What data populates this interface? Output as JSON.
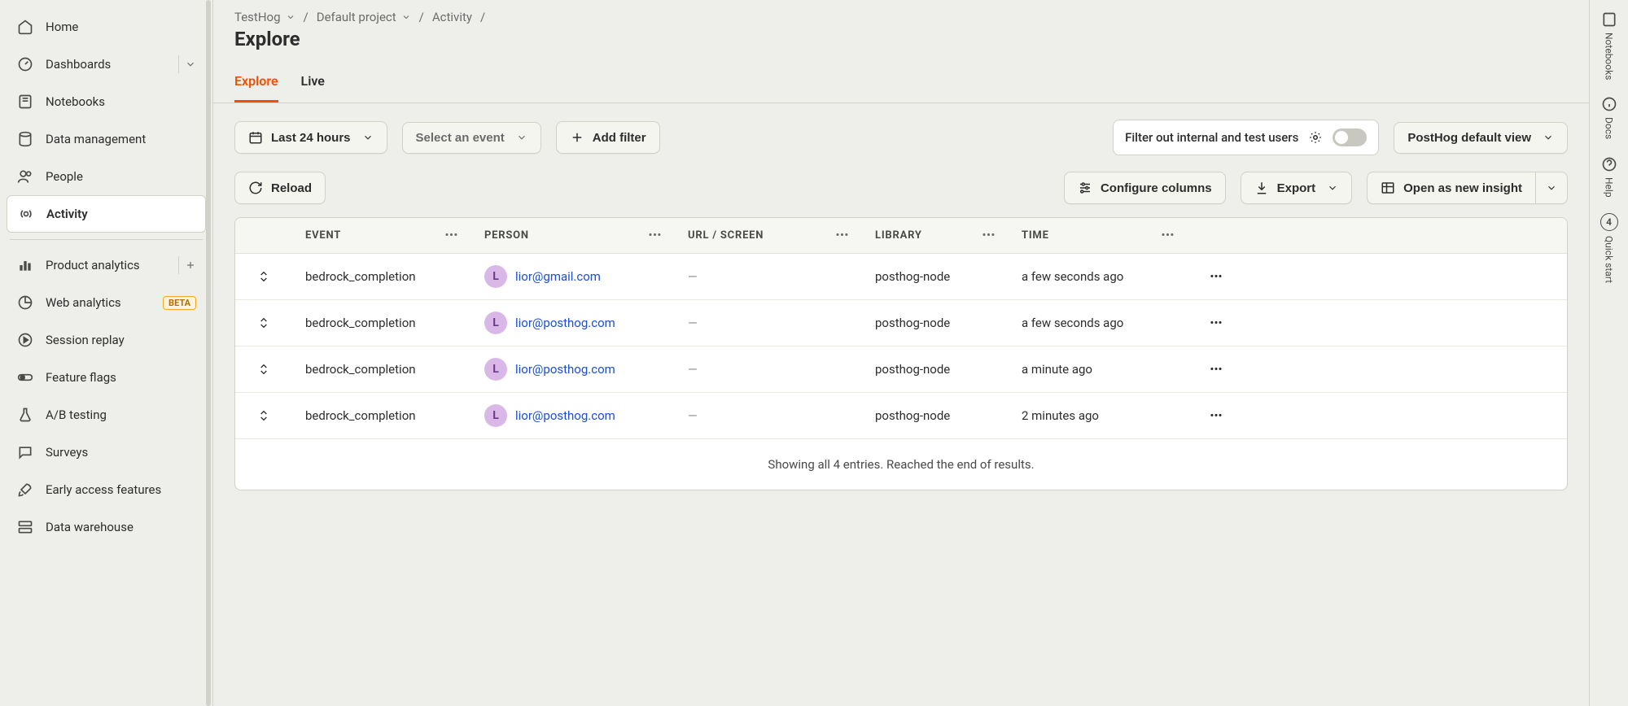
{
  "sidebar": {
    "items": [
      {
        "label": "Home"
      },
      {
        "label": "Dashboards"
      },
      {
        "label": "Notebooks"
      },
      {
        "label": "Data management"
      },
      {
        "label": "People"
      },
      {
        "label": "Activity"
      },
      {
        "label": "Product analytics"
      },
      {
        "label": "Web analytics",
        "badge": "BETA"
      },
      {
        "label": "Session replay"
      },
      {
        "label": "Feature flags"
      },
      {
        "label": "A/B testing"
      },
      {
        "label": "Surveys"
      },
      {
        "label": "Early access features"
      },
      {
        "label": "Data warehouse"
      }
    ]
  },
  "breadcrumb": {
    "org": "TestHog",
    "project": "Default project",
    "section": "Activity"
  },
  "page_title": "Explore",
  "tabs": {
    "explore": "Explore",
    "live": "Live"
  },
  "toolbar": {
    "date": "Last 24 hours",
    "select_event": "Select an event",
    "add_filter": "Add filter",
    "filter_internal": "Filter out internal and test users",
    "view": "PostHog default view"
  },
  "actions": {
    "reload": "Reload",
    "configure": "Configure columns",
    "export": "Export",
    "open_insight": "Open as new insight"
  },
  "columns": {
    "event": "EVENT",
    "person": "PERSON",
    "url": "URL / SCREEN",
    "library": "LIBRARY",
    "time": "TIME"
  },
  "rows": [
    {
      "event": "bedrock_completion",
      "initial": "L",
      "person": "lior@gmail.com",
      "url": "—",
      "library": "posthog-node",
      "time": "a few seconds ago"
    },
    {
      "event": "bedrock_completion",
      "initial": "L",
      "person": "lior@posthog.com",
      "url": "—",
      "library": "posthog-node",
      "time": "a few seconds ago"
    },
    {
      "event": "bedrock_completion",
      "initial": "L",
      "person": "lior@posthog.com",
      "url": "—",
      "library": "posthog-node",
      "time": "a minute ago"
    },
    {
      "event": "bedrock_completion",
      "initial": "L",
      "person": "lior@posthog.com",
      "url": "—",
      "library": "posthog-node",
      "time": "2 minutes ago"
    }
  ],
  "footer": "Showing all 4 entries. Reached the end of results.",
  "rail": {
    "notebooks": "Notebooks",
    "docs": "Docs",
    "help": "Help",
    "quick": "Quick start",
    "quick_count": "4"
  }
}
